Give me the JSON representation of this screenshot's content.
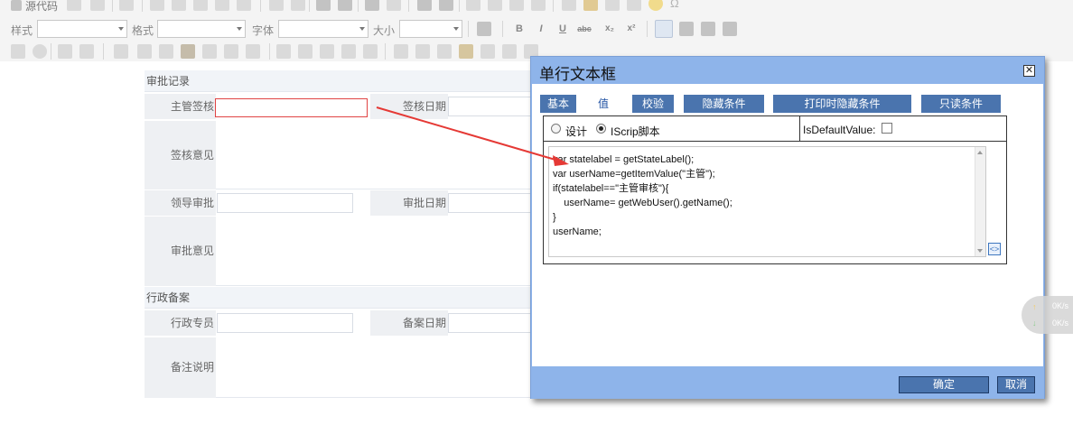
{
  "toolbar": {
    "source_label": "源代码",
    "style_label": "样式",
    "format_label": "格式",
    "font_label": "字体",
    "size_label": "大小",
    "bold": "B",
    "italic": "I",
    "underline": "U",
    "strike": "abc",
    "subscript": "x₂",
    "superscript": "x²"
  },
  "form": {
    "section_approval": "审批记录",
    "manager_sign_label": "主管签核",
    "sign_date_label": "签核日期",
    "sign_opinion_label": "签核意见",
    "leader_approve_label": "领导审批",
    "approve_date_label": "审批日期",
    "approve_opinion_label": "审批意见",
    "section_admin": "行政备案",
    "admin_staff_label": "行政专员",
    "record_date_label": "备案日期",
    "remark_label": "备注说明"
  },
  "dialog": {
    "title": "单行文本框",
    "close_glyph": "✕",
    "tabs": [
      "基本",
      "值",
      "校验",
      "隐藏条件",
      "打印时隐藏条件",
      "只读条件"
    ],
    "active_tab": "值",
    "radio_design": "设计",
    "radio_script": "IScrip脚本",
    "selected_mode": "IScrip脚本",
    "default_value_label": "IsDefaultValue:",
    "default_value_checked": false,
    "script": "var statelabel = getStateLabel();\nvar userName=getItemValue(\"主管\");\nif(statelabel==\"主管审核\"){\n    userName= getWebUser().getName();\n}\nuserName;",
    "ok_button": "确定",
    "cancel_button": "取消"
  },
  "speed_widget": {
    "upload": "0K/s",
    "download": "0K/s"
  },
  "colors": {
    "dialog_frame": "#8eb4ea",
    "tab_bg": "#4a74ae",
    "annotation_arrow": "#e53935",
    "required_border": "#e04444"
  }
}
